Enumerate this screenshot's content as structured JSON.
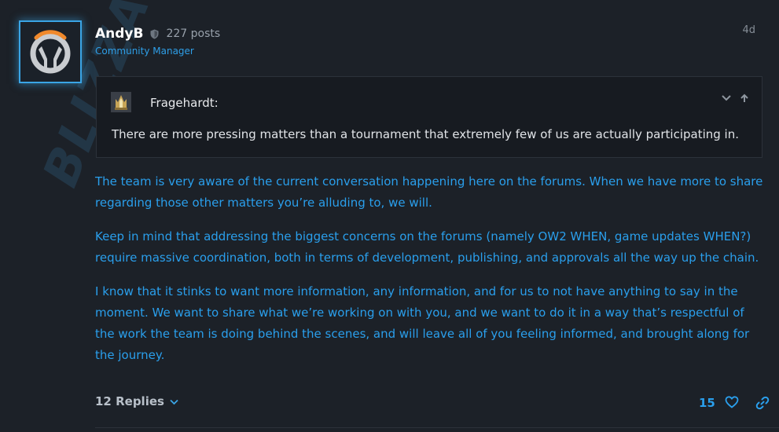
{
  "post": {
    "author": "AndyB",
    "post_count": "227 posts",
    "author_title": "Community Manager",
    "age": "4d",
    "watermark": "BLIZZARD"
  },
  "quote": {
    "author": "Fragehardt:",
    "text": "There are more pressing matters than a tournament that extremely few of us are actually participating in."
  },
  "body": {
    "paragraphs": [
      "The team is very aware of the current conversation happening here on the forums. When we have more to share regarding those other matters you’re alluding to, we will.",
      "Keep in mind that addressing the biggest concerns on the forums (namely OW2 WHEN, game updates WHEN?) require massive coordination, both in terms of development, publishing, and approvals all the way up the chain.",
      "I know that it stinks to want more information, any information, and for us to not have anything to say in the moment. We want to share what we’re working on with you, and we want to do it in a way that’s respectful of the work the team is doing behind the scenes, and will leave all of you feeling informed, and brought along for the journey."
    ]
  },
  "footer": {
    "replies_label": "12 Replies",
    "like_count": "15"
  },
  "icons": {
    "avatar": "overwatch-logo-icon",
    "badge": "shield-icon",
    "quote_avatar": "crown-avatar-icon",
    "expand": "chevron-down-icon",
    "jump": "arrow-up-icon",
    "replies": "chevron-down-icon",
    "like": "heart-icon",
    "share": "link-icon"
  },
  "colors": {
    "background": "#1c2128",
    "accent": "#2a9fec",
    "quote_bg": "#171b21",
    "avatar_glow": "#3aa5e6"
  }
}
